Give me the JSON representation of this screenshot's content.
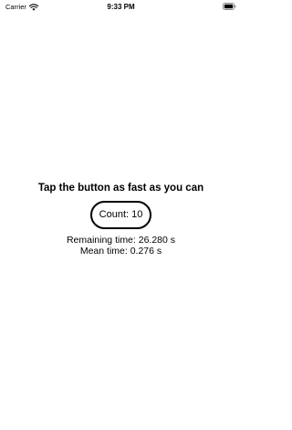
{
  "status_bar": {
    "carrier": "Carrier",
    "time": "9:33 PM",
    "wifi_icon": "wifi-icon",
    "battery_icon": "battery-icon"
  },
  "main": {
    "prompt": "Tap the button as fast as you can",
    "count_button_label": "Count: 10",
    "remaining_time": "Remaining time: 26.280 s",
    "mean_time": "Mean time: 0.276 s"
  }
}
